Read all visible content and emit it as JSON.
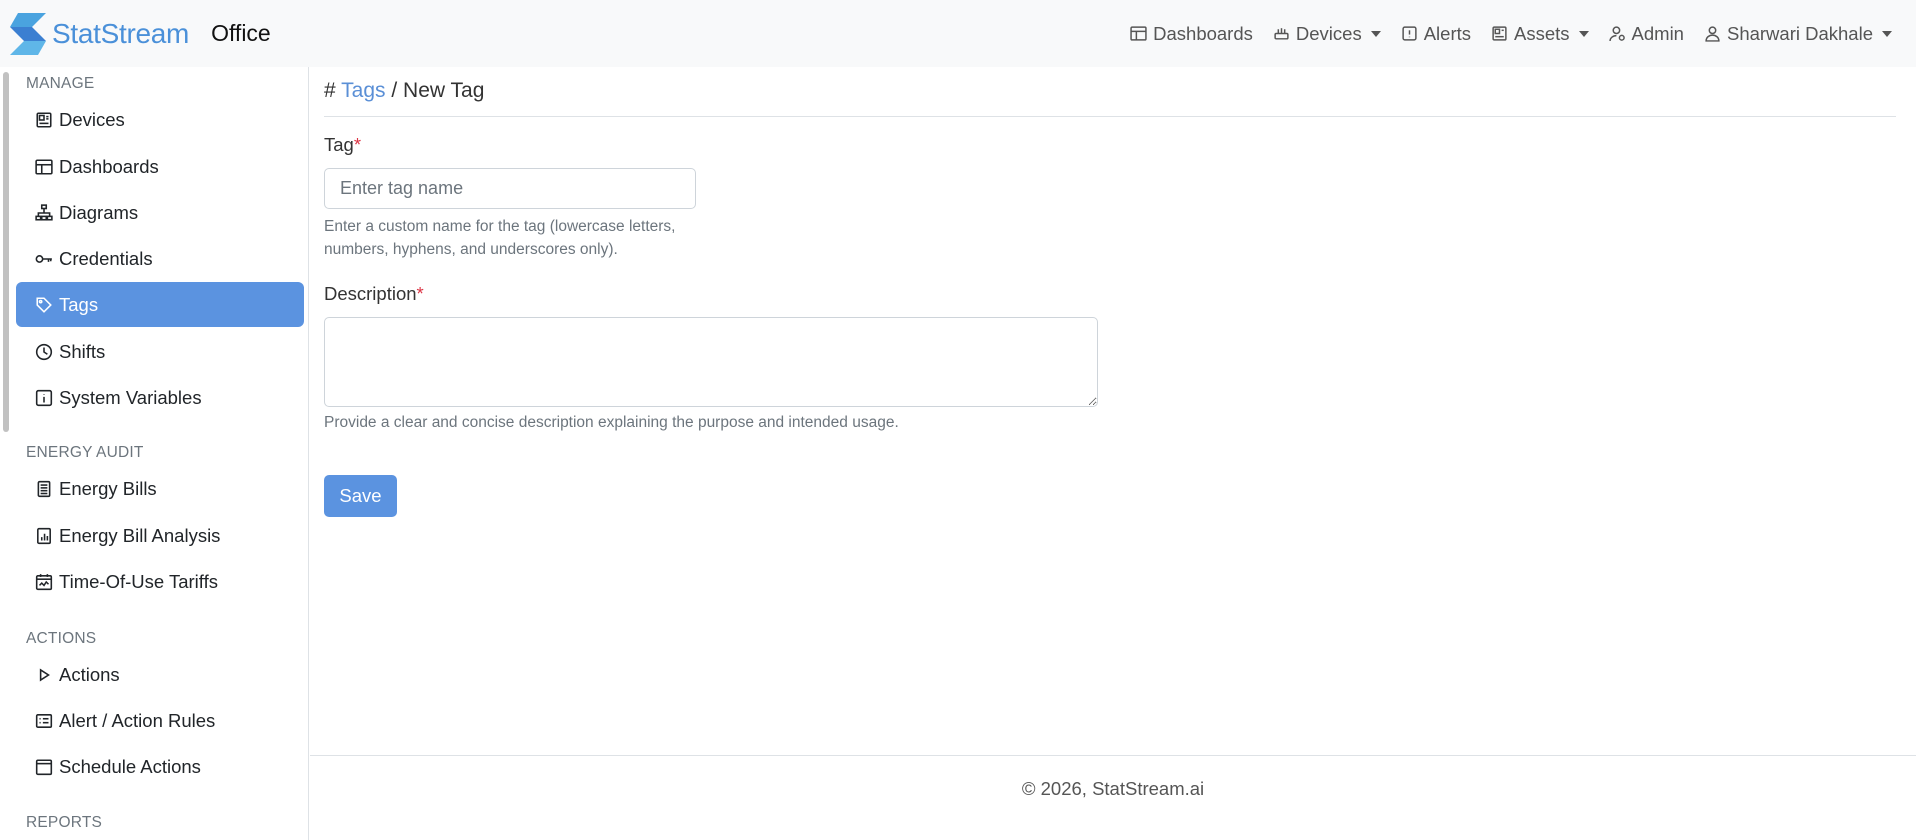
{
  "brand": {
    "name": "StatStream",
    "sub": "Office"
  },
  "topnav": [
    {
      "label": "Dashboards",
      "icon": "dashboard-icon",
      "dropdown": false
    },
    {
      "label": "Devices",
      "icon": "devices-icon",
      "dropdown": true
    },
    {
      "label": "Alerts",
      "icon": "alert-icon",
      "dropdown": false
    },
    {
      "label": "Assets",
      "icon": "assets-icon",
      "dropdown": true
    },
    {
      "label": "Admin",
      "icon": "admin-icon",
      "dropdown": false
    },
    {
      "label": "Sharwari Dakhale",
      "icon": "user-icon",
      "dropdown": true
    }
  ],
  "sidebar": {
    "sections": {
      "manage": "MANAGE",
      "energy_audit": "ENERGY AUDIT",
      "actions": "ACTIONS",
      "reports": "REPORTS"
    },
    "items": [
      {
        "label": "Devices",
        "icon": "device-icon"
      },
      {
        "label": "Dashboards",
        "icon": "dashboard-icon"
      },
      {
        "label": "Diagrams",
        "icon": "diagram-icon"
      },
      {
        "label": "Credentials",
        "icon": "key-icon"
      },
      {
        "label": "Tags",
        "icon": "tag-icon",
        "active": true
      },
      {
        "label": "Shifts",
        "icon": "clock-icon"
      },
      {
        "label": "System Variables",
        "icon": "info-icon"
      },
      {
        "label": "Energy Bills",
        "icon": "bill-icon"
      },
      {
        "label": "Energy Bill Analysis",
        "icon": "chart-icon"
      },
      {
        "label": "Time-Of-Use Tariffs",
        "icon": "calendar-icon"
      },
      {
        "label": "Actions",
        "icon": "play-icon"
      },
      {
        "label": "Alert / Action Rules",
        "icon": "rules-icon"
      },
      {
        "label": "Schedule Actions",
        "icon": "schedule-icon"
      }
    ]
  },
  "breadcrumb": {
    "prefix": "#",
    "link": "Tags",
    "separator": "/",
    "current": "New Tag"
  },
  "form": {
    "tag_label": "Tag",
    "required_mark": "*",
    "tag_value": "",
    "tag_placeholder": "Enter tag name",
    "tag_help_line1": "Enter a custom name for the tag (lowercase letters,",
    "tag_help_line2": "numbers, hyphens, and underscores only).",
    "desc_label": "Description",
    "desc_value": "",
    "desc_help": "Provide a clear and concise description explaining the purpose and intended usage.",
    "save_label": "Save"
  },
  "footer": {
    "text": "© 2026, StatStream.ai"
  },
  "colors": {
    "accent": "#5b93e0",
    "link": "#5a8fd6",
    "required": "#dc3545",
    "navbar_bg": "#f8f9fa"
  }
}
